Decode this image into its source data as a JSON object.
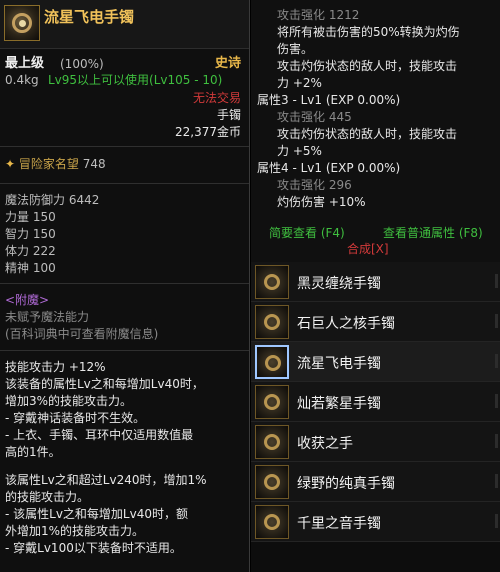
{
  "item": {
    "name": "流星飞电手镯",
    "grade": "最上级",
    "grade_pct": "(100%)",
    "rarity": "史诗",
    "weight": "0.4kg",
    "level_req": "Lv95以上可以使用(Lv105 - 10)",
    "trade": "无法交易",
    "slot": "手镯",
    "price": "22,377金币",
    "fame_label": "冒险家名望",
    "fame_value": "748",
    "stats": [
      {
        "label": "魔法防御力",
        "value": "6442"
      },
      {
        "label": "力量",
        "value": "150"
      },
      {
        "label": "智力",
        "value": "150"
      },
      {
        "label": "体力",
        "value": "222"
      },
      {
        "label": "精神",
        "value": "100"
      }
    ],
    "enchant_title": "<附魔>",
    "enchant_line1": "未赋予魔法能力",
    "enchant_line2": "(百科词典中可查看附魔信息)",
    "desc_lines": [
      "技能攻击力 +12%",
      "该装备的属性Lv之和每增加Lv40时，",
      "增加3%的技能攻击力。",
      "- 穿戴神话装备时不生效。",
      "- 上衣、手镯、耳环中仅适用数值最",
      "高的1件。"
    ],
    "desc2_lines": [
      "该属性Lv之和超过Lv240时，增加1%",
      "的技能攻击力。",
      "- 该属性Lv之和每增加Lv40时，额",
      "外增加1%的技能攻击力。",
      "- 穿戴Lv100以下装备时不适用。"
    ]
  },
  "attrs": {
    "lines": [
      {
        "text": "攻击强化 1212",
        "cls": "dim",
        "indent": true
      },
      {
        "text": "将所有被击伤害的50%转换为灼伤",
        "cls": "white",
        "indent": true
      },
      {
        "text": "伤害。",
        "cls": "white",
        "indent": true
      },
      {
        "text": "攻击灼伤状态的敌人时，技能攻击",
        "cls": "white",
        "indent": true
      },
      {
        "text": "力 +2%",
        "cls": "white",
        "indent": true
      },
      {
        "text": "属性3 - Lv1 (EXP 0.00%)",
        "cls": "white",
        "indent": false
      },
      {
        "text": "攻击强化 445",
        "cls": "dim",
        "indent": true
      },
      {
        "text": "攻击灼伤状态的敌人时，技能攻击",
        "cls": "white",
        "indent": true
      },
      {
        "text": "力 +5%",
        "cls": "white",
        "indent": true
      },
      {
        "text": "属性4 - Lv1 (EXP 0.00%)",
        "cls": "white",
        "indent": false
      },
      {
        "text": "攻击强化 296",
        "cls": "dim",
        "indent": true
      },
      {
        "text": "灼伤伤害 +10%",
        "cls": "white",
        "indent": true
      }
    ]
  },
  "links": {
    "simple": "简要查看 (F4)",
    "normal": "查看普通属性 (F8)",
    "synth": "合成[X]"
  },
  "list": [
    {
      "name": "黑灵缠绕手镯",
      "selected": false
    },
    {
      "name": "石巨人之核手镯",
      "selected": false
    },
    {
      "name": "流星飞电手镯",
      "selected": true
    },
    {
      "name": "灿若繁星手镯",
      "selected": false
    },
    {
      "name": "收获之手",
      "selected": false
    },
    {
      "name": "绿野的纯真手镯",
      "selected": false
    },
    {
      "name": "千里之音手镯",
      "selected": false
    }
  ],
  "colors": {
    "gold": "#f1c25a",
    "rarity": "#e9b84a",
    "green": "#3fbf3f",
    "red": "#d23a3a",
    "purple": "#b06ad6"
  },
  "icons": {
    "item": "bracelet-icon",
    "fame": "fame-star-icon"
  }
}
